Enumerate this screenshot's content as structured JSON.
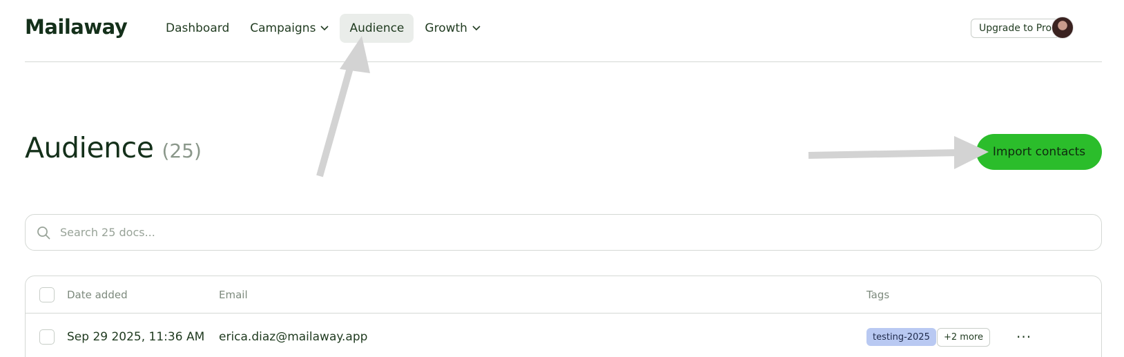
{
  "brand": {
    "logo": "Mailaway"
  },
  "nav": {
    "items": [
      {
        "label": "Dashboard",
        "has_chevron": false,
        "active": false
      },
      {
        "label": "Campaigns",
        "has_chevron": true,
        "active": false
      },
      {
        "label": "Audience",
        "has_chevron": false,
        "active": true
      },
      {
        "label": "Growth",
        "has_chevron": true,
        "active": false
      }
    ]
  },
  "header": {
    "upgrade_label": "Upgrade to Pro",
    "avatar_icon": "user-avatar"
  },
  "page": {
    "title": "Audience",
    "count": "(25)",
    "import_label": "Import contacts"
  },
  "search": {
    "placeholder": "Search 25 docs...",
    "value": "",
    "icon": "search-icon"
  },
  "table": {
    "columns": {
      "date": "Date added",
      "email": "Email",
      "tags": "Tags"
    },
    "rows": [
      {
        "date": "Sep 29 2025, 11:36 AM",
        "email": "erica.diaz@mailaway.app",
        "tag": "testing-2025",
        "more": "+2 more",
        "menu": "···"
      }
    ]
  },
  "colors": {
    "accent": "#2bbd2b",
    "active_nav_bg": "#eaedea",
    "tag_bg": "#b9c9f2",
    "annotation_arrow": "#d3d3d3"
  }
}
